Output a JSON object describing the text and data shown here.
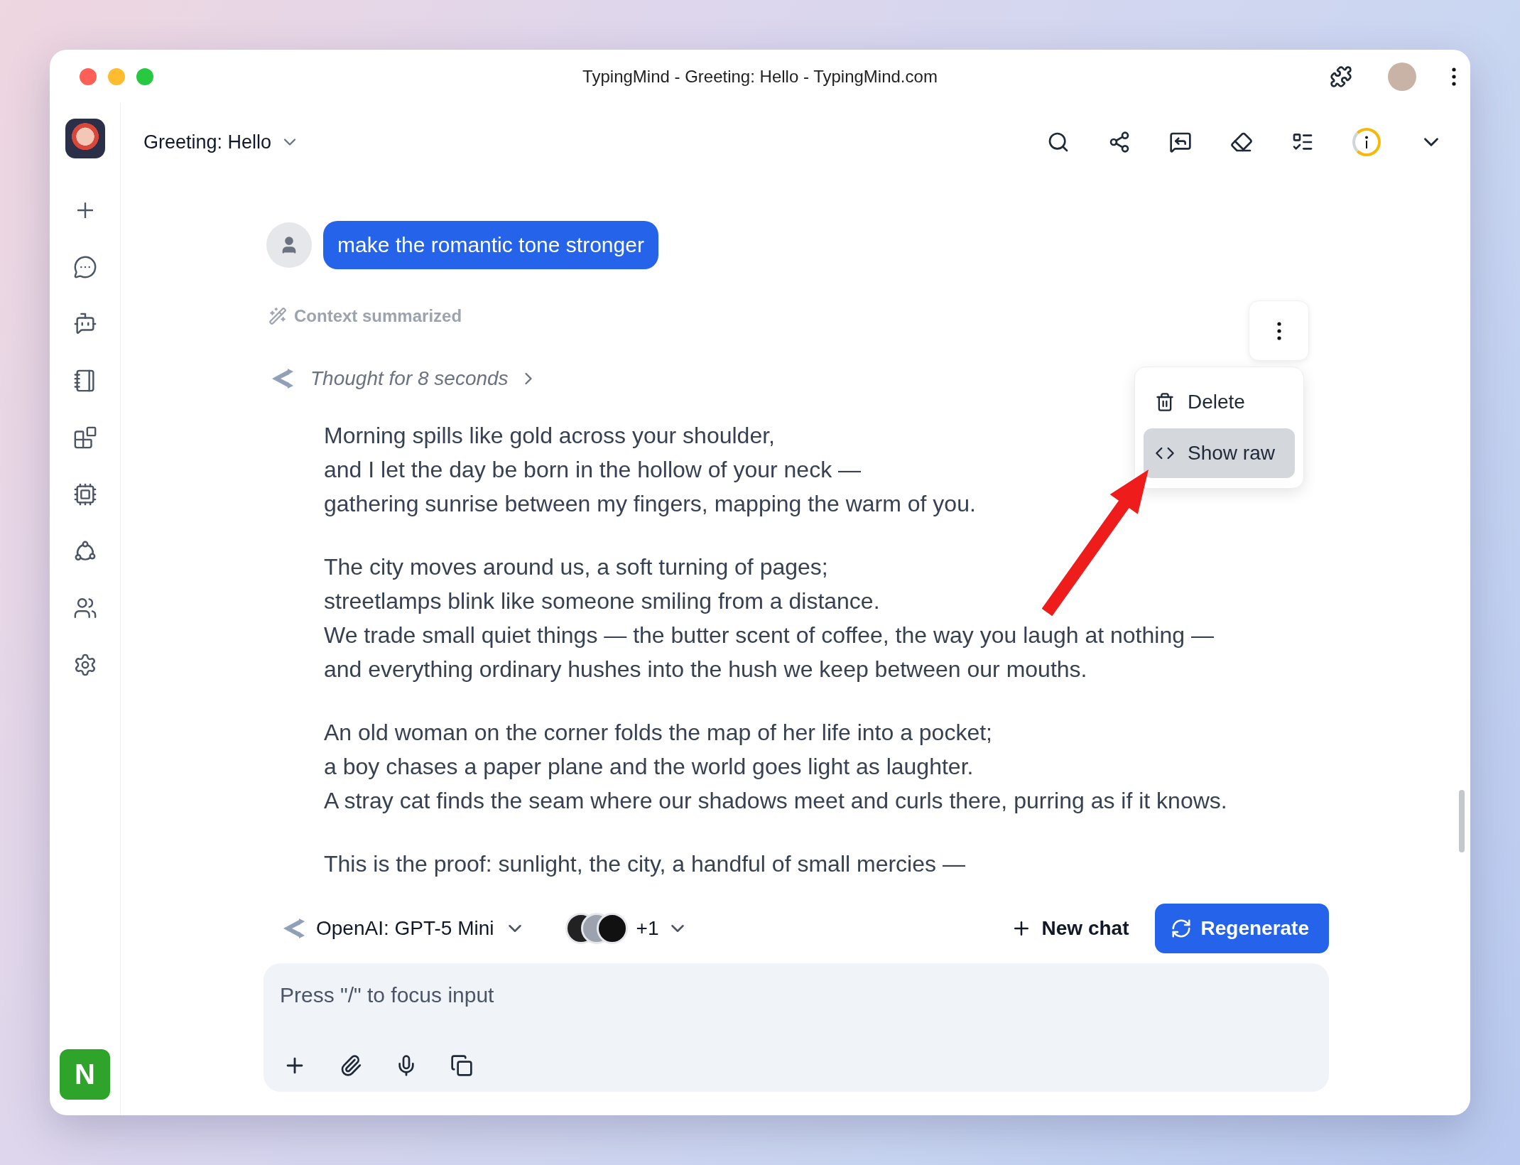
{
  "window": {
    "title": "TypingMind - Greeting: Hello - TypingMind.com"
  },
  "header": {
    "chat_title": "Greeting: Hello"
  },
  "sidebar": {
    "profile_initial": "N"
  },
  "conversation": {
    "user_message": "make the romantic tone stronger",
    "context_note": "Context summarized",
    "thought": "Thought for 8 seconds",
    "stanzas": [
      [
        "Morning spills like gold across your shoulder,",
        "and I let the day be born in the hollow of your neck —",
        "gathering sunrise between my fingers, mapping the warm of you."
      ],
      [
        "The city moves around us, a soft turning of pages;",
        "streetlamps blink like someone smiling from a distance.",
        "We trade small quiet things — the butter scent of coffee, the way you laugh at nothing —",
        "and everything ordinary hushes into the hush we keep between our mouths."
      ],
      [
        "An old woman on the corner folds the map of her life into a pocket;",
        "a boy chases a paper plane and the world goes light as laughter.",
        "A stray cat finds the seam where our shadows meet and curls there, purring as if it knows."
      ],
      [
        "This is the proof: sunlight, the city, a handful of small mercies —"
      ]
    ]
  },
  "message_menu": {
    "items": [
      {
        "label": "Delete",
        "kind": "delete",
        "selected": false
      },
      {
        "label": "Show raw",
        "kind": "raw",
        "selected": true
      }
    ]
  },
  "composer": {
    "model": "OpenAI: GPT-5 Mini",
    "extra_models": "+1",
    "new_chat": "New chat",
    "regenerate": "Regenerate",
    "placeholder": "Press \"/\" to focus input"
  }
}
